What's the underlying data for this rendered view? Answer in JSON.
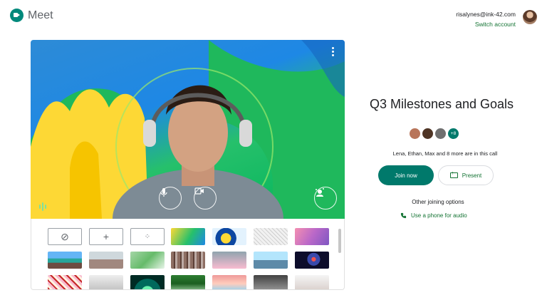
{
  "app": {
    "name": "Meet"
  },
  "account": {
    "email": "risalynes@ink-42.com",
    "switch_label": "Switch account"
  },
  "meeting": {
    "title": "Q3 Milestones and Goals",
    "participants": [
      {
        "name": "Lena",
        "color": "#b8755a"
      },
      {
        "name": "Ethan",
        "color": "#4e3424"
      },
      {
        "name": "Max",
        "color": "#6f6f6f"
      }
    ],
    "more_count_label": "+8",
    "in_call_text": "Lena, Ethan, Max and 8 more are in this call",
    "join_label": "Join now",
    "present_label": "Present",
    "other_options_label": "Other joining options",
    "phone_label": "Use a phone for audio"
  },
  "preview": {
    "controls": [
      "microphone-icon",
      "camera-icon"
    ],
    "effects_icon": "effects-icon",
    "more_icon": "more-vert-icon",
    "audio_level_icon": "audio-level-icon"
  },
  "backgrounds": {
    "options": [
      {
        "name": "no-effect",
        "glyph": "⊘"
      },
      {
        "name": "blur-slight",
        "glyph": "+"
      },
      {
        "name": "blur",
        "glyph": "⁘"
      }
    ]
  },
  "colors": {
    "accent": "#00796b",
    "link": "#137333"
  }
}
